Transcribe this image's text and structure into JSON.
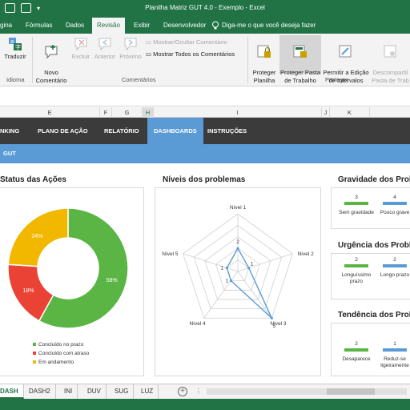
{
  "window": {
    "title": "Planilha Matriz GUT 4.0 - Exemplo  -  Excel"
  },
  "ribbon_tabs": [
    "gina",
    "Fórmulas",
    "Dados",
    "Revisão",
    "Exibir",
    "Desenvolvedor"
  ],
  "tell_me": "Diga-me o que você deseja fazer",
  "ribbon": {
    "idioma": {
      "translate": "Traduzir",
      "group": "Idioma"
    },
    "comentarios": {
      "novo": "Novo\nComentário",
      "excluir": "Excluir",
      "anterior": "Anterior",
      "proximo": "Próximo",
      "mostrar_ocultar": "Mostrar/Ocultar Comentário",
      "mostrar_todos": "Mostrar Todos os Comentários",
      "group": "Comentários"
    },
    "proteger": {
      "planilha": "Proteger\nPlanilha",
      "pasta": "Proteger Pasta\nde Trabalho",
      "permitir": "Permitir a Edição\nde Intervalos",
      "descompartilhar": "Descompartil\nPasta de Trab",
      "group": "Proteger"
    }
  },
  "columns": [
    "E",
    "F",
    "G",
    "H",
    "I",
    "J",
    "K"
  ],
  "nav": [
    "NKING",
    "PLANO DE AÇÃO",
    "RELATÓRIO",
    "DASHBOARDS",
    "INSTRUÇÕES"
  ],
  "nav_active": "DASHBOARDS",
  "section_label": "GUT",
  "status_chart": {
    "title": "Status das Ações",
    "chart_data": {
      "type": "pie",
      "categories": [
        "Concluído no prazo",
        "Concluído com atraso",
        "Em andamento"
      ],
      "values": [
        58,
        18,
        24
      ],
      "labels": [
        "58%",
        "18%",
        "24%"
      ],
      "colors": [
        "#5bb544",
        "#ea4335",
        "#f2b800"
      ]
    }
  },
  "radar_chart": {
    "title": "Níveis dos problemas",
    "chart_data": {
      "type": "radar",
      "axes": [
        "Nível 1",
        "Nível 2",
        "Nível 3",
        "Nível 4",
        "Nível 5"
      ],
      "values": [
        2,
        1,
        5,
        1,
        1
      ],
      "max": 5,
      "value_labels": [
        "2",
        "1",
        "5",
        "1",
        "1"
      ],
      "color": "#5b9bd5"
    }
  },
  "gravidade": {
    "title": "Gravidade dos Probl",
    "chart_data": {
      "type": "bar",
      "categories": [
        "Sem gravidade",
        "Pouco grave"
      ],
      "values": [
        3,
        4
      ],
      "colors": [
        "#5bb544",
        "#5b9bd5"
      ]
    }
  },
  "urgencia": {
    "title": "Urgência dos Proble",
    "chart_data": {
      "type": "bar",
      "categories": [
        "Longuíssimo\nprazo",
        "Longo prazo"
      ],
      "values": [
        2,
        2
      ],
      "colors": [
        "#5bb544",
        "#5b9bd5"
      ]
    }
  },
  "tendencia": {
    "title": "Tendência dos Probl",
    "chart_data": {
      "type": "bar",
      "categories": [
        "Desaparece",
        "Reduz-se\nligeiramente"
      ],
      "values": [
        2,
        1
      ],
      "colors": [
        "#5bb544",
        "#5b9bd5"
      ]
    }
  },
  "sheet_tabs": [
    "DASH",
    "DASH2",
    "INI",
    "DUV",
    "SUG",
    "LUZ"
  ],
  "active_sheet": "DASH"
}
